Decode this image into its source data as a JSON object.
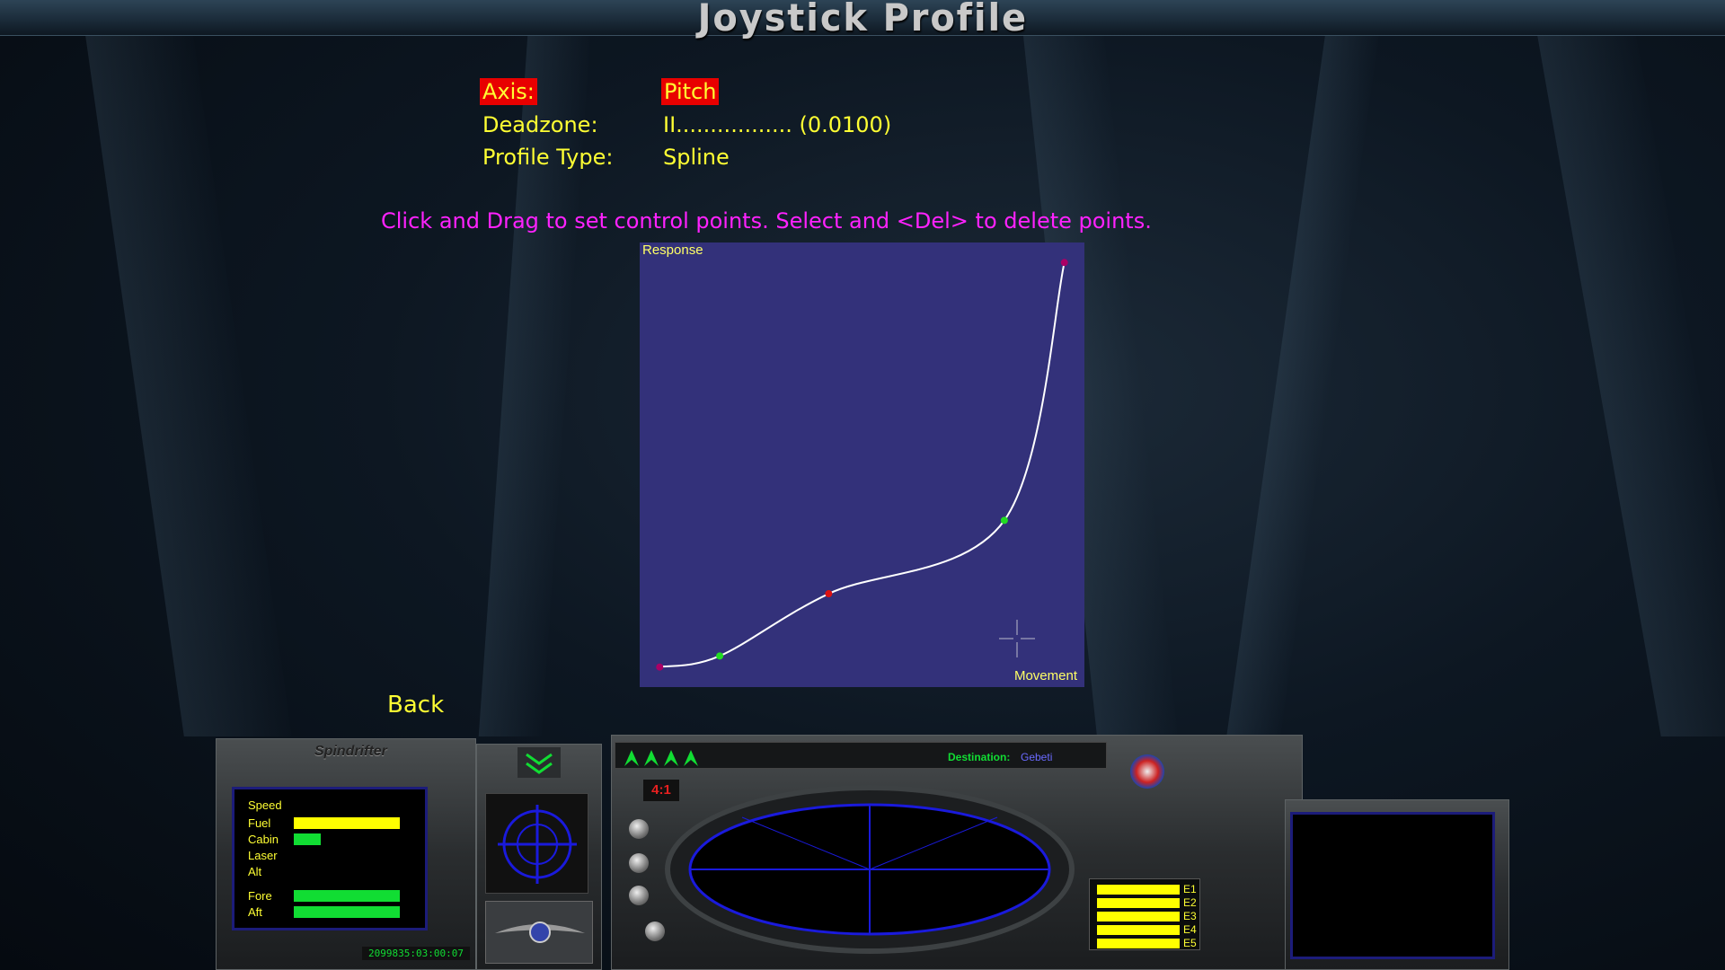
{
  "title": "Joystick Profile",
  "settings": {
    "axis_label": "Axis:",
    "axis_value": "Pitch",
    "deadzone_label": "Deadzone:",
    "deadzone_value": "II................. (0.0100)",
    "profile_type_label": "Profile Type:",
    "profile_type_value": "Spline"
  },
  "instructions": "Click and Drag to set control points. Select and <Del> to delete points.",
  "graph": {
    "y_label": "Response",
    "x_label": "Movement",
    "background": "#33317a",
    "curve_color": "#ffffff",
    "control_points": [
      {
        "movement": 0.045,
        "response": 0.045,
        "color": "#aa0066"
      },
      {
        "movement": 0.18,
        "response": 0.07,
        "color": "#22dd22"
      },
      {
        "movement": 0.425,
        "response": 0.21,
        "color": "#dd1111"
      },
      {
        "movement": 0.82,
        "response": 0.375,
        "color": "#22dd22"
      },
      {
        "movement": 0.955,
        "response": 0.955,
        "color": "#aa0066"
      }
    ]
  },
  "back_label": "Back",
  "cockpit": {
    "ship_name": "Spindrifter",
    "destination_label": "Destination:",
    "destination_value": "Gebeti",
    "time_compression": "4:1",
    "date_time": "2099835:03:00:07",
    "gauges": {
      "speed": "Speed",
      "fuel": "Fuel",
      "cabin": "Cabin",
      "laser": "Laser",
      "alt": "Alt",
      "fore": "Fore",
      "aft": "Aft"
    },
    "gauge_levels": {
      "fuel": 1.0,
      "cabin": 0.25,
      "fore": 1.0,
      "aft": 1.0
    },
    "energy_banks": [
      "E1",
      "E2",
      "E3",
      "E4",
      "E5"
    ],
    "accent_colors": {
      "gauge_yellow": "#ffff00",
      "gauge_green": "#11dd33",
      "scanner_blue": "#1a1adc",
      "destination_blue": "#6a6aff"
    }
  }
}
